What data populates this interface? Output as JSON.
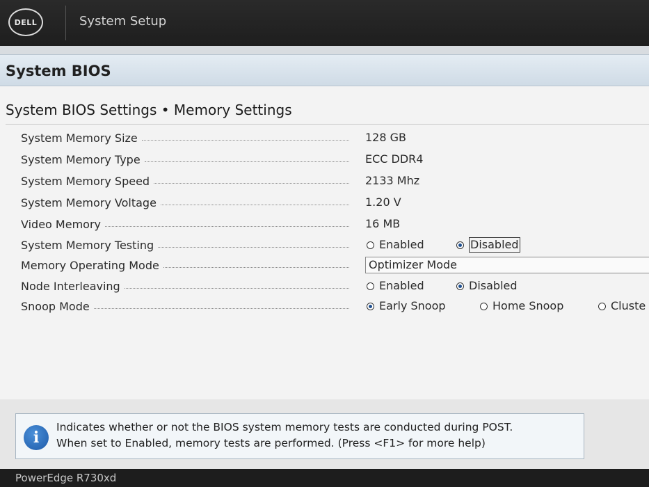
{
  "header": {
    "logo_text": "DELL",
    "title": "System Setup"
  },
  "page": {
    "band_title": "System BIOS",
    "section_title": "System BIOS Settings • Memory Settings"
  },
  "settings": {
    "memory_size": {
      "label": "System Memory Size",
      "value": "128 GB"
    },
    "memory_type": {
      "label": "System Memory Type",
      "value": "ECC DDR4"
    },
    "memory_speed": {
      "label": "System Memory Speed",
      "value": "2133 Mhz"
    },
    "memory_voltage": {
      "label": "System Memory Voltage",
      "value": "1.20 V"
    },
    "video_memory": {
      "label": "Video Memory",
      "value": "16 MB"
    },
    "memory_testing": {
      "label": "System Memory Testing",
      "options": [
        "Enabled",
        "Disabled"
      ],
      "selected": "Disabled"
    },
    "operating_mode": {
      "label": "Memory Operating Mode",
      "value": "Optimizer Mode"
    },
    "node_interleaving": {
      "label": "Node Interleaving",
      "options": [
        "Enabled",
        "Disabled"
      ],
      "selected": "Disabled"
    },
    "snoop_mode": {
      "label": "Snoop Mode",
      "options": [
        "Early Snoop",
        "Home Snoop",
        "Cluste"
      ],
      "selected": "Early Snoop"
    }
  },
  "help": {
    "icon": "info-icon",
    "line1": "Indicates whether or not the BIOS system memory tests are conducted during POST.",
    "line2": "When set to Enabled, memory tests are performed. (Press <F1> for more help)"
  },
  "footer": {
    "model": "PowerEdge R730xd"
  }
}
